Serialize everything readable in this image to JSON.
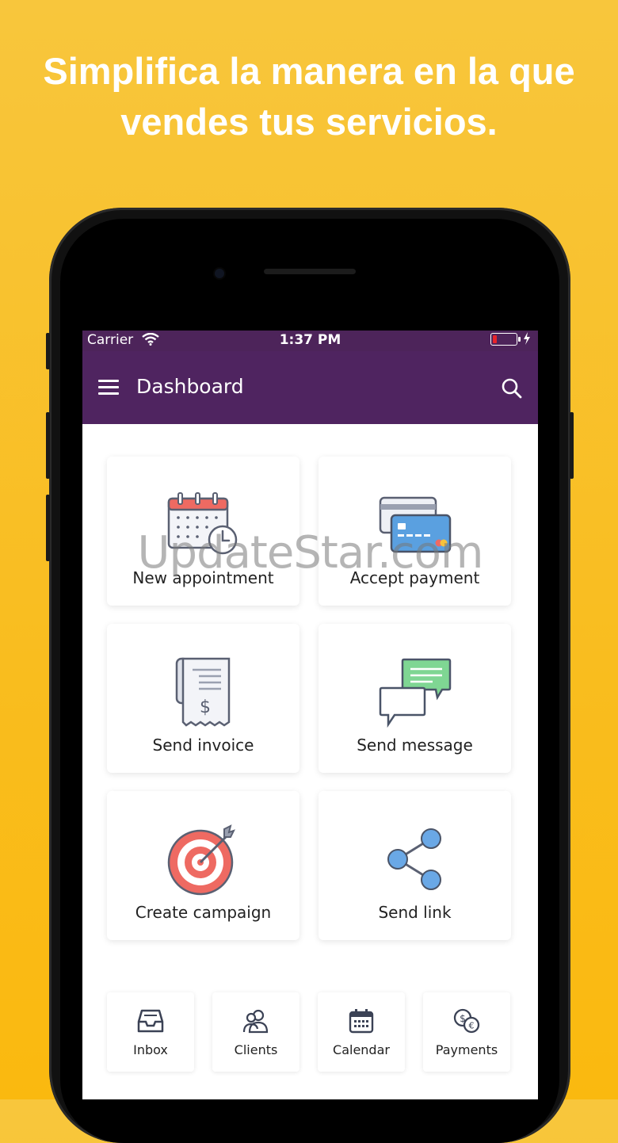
{
  "headline": {
    "line1": "Simplifica la manera en la que",
    "line2": "vendes tus servicios."
  },
  "status_bar": {
    "carrier": "Carrier",
    "time": "1:37 PM"
  },
  "app_bar": {
    "title": "Dashboard"
  },
  "tiles": [
    {
      "label": "New appointment",
      "icon": "calendar-clock-icon"
    },
    {
      "label": "Accept payment",
      "icon": "credit-cards-icon"
    },
    {
      "label": "Send invoice",
      "icon": "receipt-dollar-icon"
    },
    {
      "label": "Send message",
      "icon": "chat-bubbles-icon"
    },
    {
      "label": "Create campaign",
      "icon": "target-arrow-icon"
    },
    {
      "label": "Send link",
      "icon": "share-icon"
    }
  ],
  "bottom_nav": [
    {
      "label": "Inbox",
      "icon": "inbox-tray-icon"
    },
    {
      "label": "Clients",
      "icon": "clients-icon"
    },
    {
      "label": "Calendar",
      "icon": "calendar-icon"
    },
    {
      "label": "Payments",
      "icon": "coins-icon"
    }
  ],
  "watermark": "UpdateStar.com",
  "colors": {
    "background": "#f9c02a",
    "app_bar": "#4f2460",
    "accent_blue": "#5aa0e0",
    "accent_red": "#e8615a"
  }
}
